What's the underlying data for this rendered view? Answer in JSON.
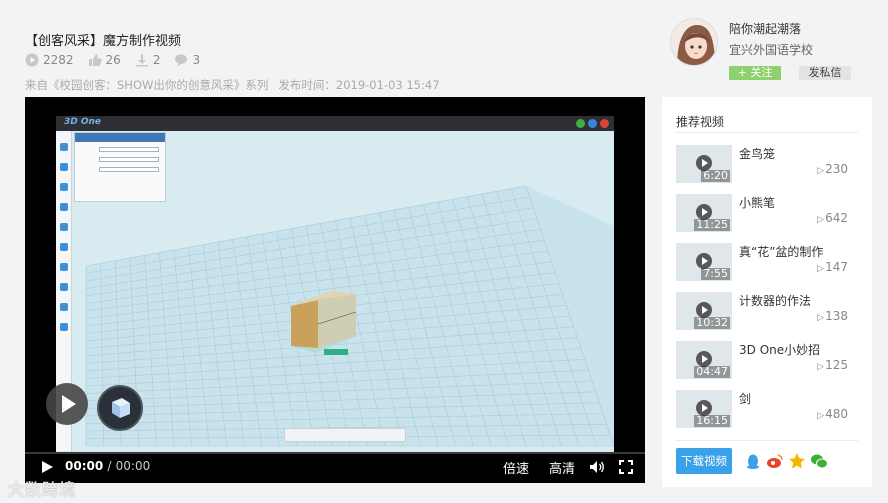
{
  "video": {
    "title": "【创客风采】魔方制作视频",
    "plays": "2282",
    "likes": "26",
    "downloads": "2",
    "comments": "3",
    "source_prefix": "来自",
    "source_link": "《校园创客：SHOW出你的创意风采》",
    "source_suffix": "系列",
    "publish_label": "发布时间：",
    "publish_time": "2019-01-03 15:47"
  },
  "user": {
    "name": "陪你潮起潮落",
    "school": "宜兴外国语学校",
    "follow_label": "+ 关注",
    "message_label": "发私信"
  },
  "player": {
    "app_name": "3D One",
    "current_time": "00:00",
    "separator": "/",
    "duration": "00:00",
    "speed_label": "倍速",
    "quality_label": "高清",
    "progress": 0
  },
  "sidebar": {
    "title": "推荐视频",
    "items": [
      {
        "title": "金鸟笼",
        "duration": "6:20",
        "views": "230"
      },
      {
        "title": "小熊笔",
        "duration": "11:25",
        "views": "642"
      },
      {
        "title": "真“花”盆的制作",
        "duration": "7:55",
        "views": "147"
      },
      {
        "title": "计数器的作法",
        "duration": "10:32",
        "views": "138"
      },
      {
        "title": "3D One小妙招",
        "duration": "04:47",
        "views": "125"
      },
      {
        "title": "剑",
        "duration": "16:15",
        "views": "480"
      }
    ],
    "download_label": "下载视频",
    "share_icons": [
      "qq-icon",
      "weibo-icon",
      "qzone-icon",
      "wechat-icon"
    ]
  },
  "watermark": "大数跨境",
  "colors": {
    "accent_blue": "#3aa0e8",
    "follow_green": "#8fd16c",
    "page_bg": "#f2f3f5"
  }
}
